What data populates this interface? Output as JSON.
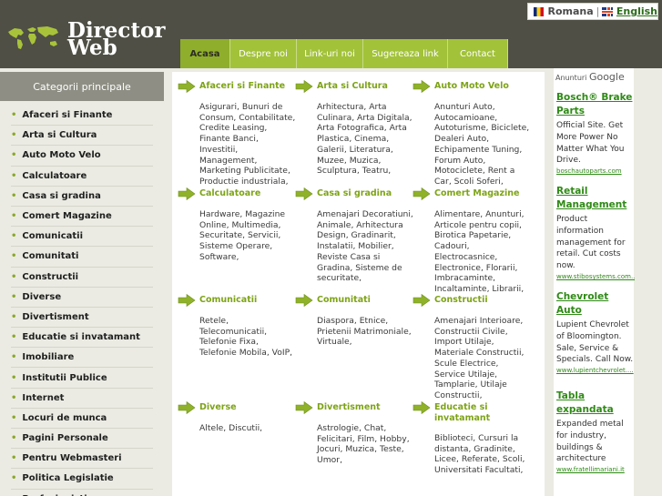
{
  "header": {
    "logo_line1": "Director",
    "logo_line2": "Web"
  },
  "language": {
    "romanian": "Romana",
    "separator": "|",
    "english": "English"
  },
  "nav": {
    "items": [
      "Acasa",
      "Despre noi",
      "Link-uri noi",
      "Sugereaza link",
      "Contact"
    ],
    "active": "Acasa"
  },
  "sidebar": {
    "title": "Categorii principale",
    "items": [
      "Afaceri si Finante",
      "Arta si Cultura",
      "Auto Moto Velo",
      "Calculatoare",
      "Casa si gradina",
      "Comert Magazine",
      "Comunicatii",
      "Comunitati",
      "Constructii",
      "Diverse",
      "Divertisment",
      "Educatie si invatamant",
      "Imobiliare",
      "Institutii Publice",
      "Internet",
      "Locuri de munca",
      "Pagini Personale",
      "Pentru Webmasteri",
      "Politica Legislatie",
      "Profesionisti"
    ]
  },
  "categories": [
    {
      "title": "Afaceri si Finante",
      "desc": "Asigurari, Bunuri de Consum, Contabilitate, Credite Leasing, Finante Banci, Investitii, Management, Marketing Publicitate, Productie industriala,"
    },
    {
      "title": "Arta si Cultura",
      "desc": "Arhitectura, Arta Culinara, Arta Digitala, Arta Fotografica, Arta Plastica, Cinema, Galerii, Literatura, Muzee, Muzica, Sculptura, Teatru,"
    },
    {
      "title": "Auto Moto Velo",
      "desc": "Anunturi Auto, Autocamioane, Autoturisme, Biciclete, Dealeri Auto, Echipamente Tuning, Forum Auto, Motociclete, Rent a Car, Scoli Soferi,"
    },
    {
      "title": "Calculatoare",
      "desc": "Hardware, Magazine Online, Multimedia, Securitate, Servicii, Sisteme Operare, Software,"
    },
    {
      "title": "Casa si gradina",
      "desc": "Amenajari Decoratiuni, Animale, Arhitectura Design, Gradinarit, Instalatii, Mobilier, Reviste Casa si Gradina, Sisteme de securitate,"
    },
    {
      "title": "Comert Magazine",
      "desc": "Alimentare, Anunturi, Articole pentru copii, Birotica Papetarie, Cadouri, Electrocasnice, Electronice, Florarii, Imbracaminte, Incaltaminte, Librarii,"
    },
    {
      "title": "Comunicatii",
      "desc": "Retele, Telecomunicatii, Telefonie Fixa, Telefonie Mobila, VoIP,"
    },
    {
      "title": "Comunitati",
      "desc": "Diaspora, Etnice, Prietenii Matrimoniale, Virtuale,"
    },
    {
      "title": "Constructii",
      "desc": "Amenajari Interioare, Constructii Civile, Import Utilaje, Materiale Constructii, Scule Electrice, Service Utilaje, Tamplarie, Utilaje Constructii,"
    },
    {
      "title": "Diverse",
      "desc": "Altele, Discutii,"
    },
    {
      "title": "Divertisment",
      "desc": "Astrologie, Chat, Felicitari, Film, Hobby, Jocuri, Muzica, Teste, Umor,"
    },
    {
      "title": "Educatie si invatamant",
      "desc": "Biblioteci, Cursuri la distanta, Gradinite, Licee, Referate, Scoli, Universitati Facultati,"
    }
  ],
  "ads": {
    "label_prefix": "Anunturi",
    "label_brand": "Google",
    "items": [
      {
        "title": "Bosch® Brake Parts",
        "text": "Official Site. Get More Power No Matter What You Drive.",
        "url": "boschautoparts.com"
      },
      {
        "title": "Retail Management",
        "text": "Product information management for retail. Cut costs now.",
        "url": "www.stibosystems.com..."
      },
      {
        "title": "Chevrolet Auto",
        "text": "Lupient Chevrolet of Bloomington. Sale, Service & Specials. Call Now.",
        "url": "www.lupientchevrolet...."
      },
      {
        "title": "Tabla expandata",
        "text": "Expanded metal for industry, buildings & architecture",
        "url": "www.fratellimariani.it"
      }
    ]
  },
  "colors": {
    "header_bg": "#4f4f45",
    "nav_green": "#a2c23a",
    "category_green": "#7ea317",
    "ad_link_green": "#2f8a16"
  }
}
